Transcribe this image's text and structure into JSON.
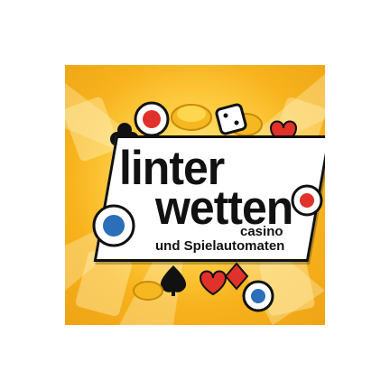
{
  "logo": {
    "line1": "linter",
    "line2": "wetten",
    "line3": "casino",
    "line4": "und Spielautomaten"
  },
  "colors": {
    "background": "#ffffff",
    "tile_yellow": "#ffd24a",
    "tile_orange": "#f7b21c",
    "text": "#111111",
    "frame": "#111111",
    "accent_red": "#e0322a",
    "chip_blue": "#2a6fb8"
  },
  "icons": [
    "club-icon",
    "heart-icon",
    "spade-icon",
    "diamond-icon",
    "dice-icon",
    "gold-coin-icon",
    "casino-chip-icon"
  ]
}
